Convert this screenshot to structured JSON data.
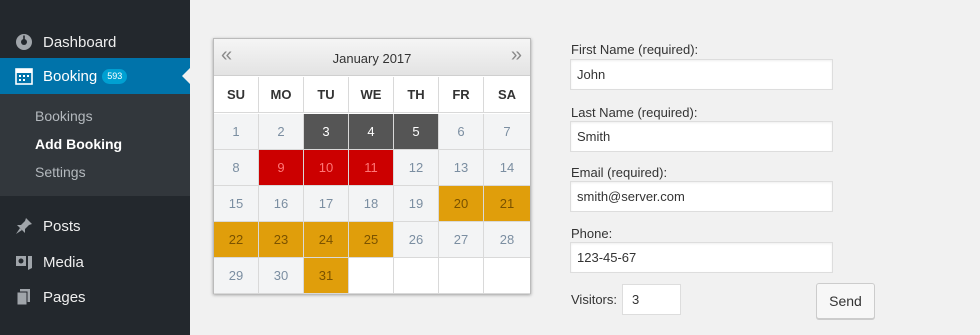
{
  "sidebar": {
    "items": [
      {
        "label": "Dashboard",
        "icon": "dashboard-icon"
      },
      {
        "label": "Booking",
        "icon": "calendar-icon",
        "badge": "593",
        "active": true
      },
      {
        "label": "Posts",
        "icon": "pin-icon"
      },
      {
        "label": "Media",
        "icon": "media-icon"
      },
      {
        "label": "Pages",
        "icon": "pages-icon"
      }
    ],
    "submenu": [
      {
        "label": "Bookings"
      },
      {
        "label": "Add Booking",
        "current": true
      },
      {
        "label": "Settings"
      }
    ]
  },
  "calendar": {
    "title": "January 2017",
    "prev": "«",
    "next": "»",
    "weekdays": [
      "SU",
      "MO",
      "TU",
      "WE",
      "TH",
      "FR",
      "SA"
    ],
    "weeks": [
      [
        {
          "d": "1",
          "s": "available"
        },
        {
          "d": "2",
          "s": "available"
        },
        {
          "d": "3",
          "s": "unavailable"
        },
        {
          "d": "4",
          "s": "unavailable"
        },
        {
          "d": "5",
          "s": "unavailable"
        },
        {
          "d": "6",
          "s": "available"
        },
        {
          "d": "7",
          "s": "available"
        }
      ],
      [
        {
          "d": "8",
          "s": "available"
        },
        {
          "d": "9",
          "s": "booked"
        },
        {
          "d": "10",
          "s": "booked"
        },
        {
          "d": "11",
          "s": "booked"
        },
        {
          "d": "12",
          "s": "available"
        },
        {
          "d": "13",
          "s": "available"
        },
        {
          "d": "14",
          "s": "available"
        }
      ],
      [
        {
          "d": "15",
          "s": "available"
        },
        {
          "d": "16",
          "s": "available"
        },
        {
          "d": "17",
          "s": "available"
        },
        {
          "d": "18",
          "s": "available"
        },
        {
          "d": "19",
          "s": "available"
        },
        {
          "d": "20",
          "s": "pending"
        },
        {
          "d": "21",
          "s": "pending"
        }
      ],
      [
        {
          "d": "22",
          "s": "pending"
        },
        {
          "d": "23",
          "s": "pending"
        },
        {
          "d": "24",
          "s": "pending"
        },
        {
          "d": "25",
          "s": "pending"
        },
        {
          "d": "26",
          "s": "available"
        },
        {
          "d": "27",
          "s": "available"
        },
        {
          "d": "28",
          "s": "available"
        }
      ],
      [
        {
          "d": "29",
          "s": "available"
        },
        {
          "d": "30",
          "s": "available"
        },
        {
          "d": "31",
          "s": "pending"
        },
        {
          "d": "",
          "s": "empty"
        },
        {
          "d": "",
          "s": "empty"
        },
        {
          "d": "",
          "s": "empty"
        },
        {
          "d": "",
          "s": "empty"
        }
      ]
    ],
    "colors": {
      "unavailable": "#555555",
      "booked": "#cc0000",
      "pending": "#e09e0b",
      "available": "#f3f4f5"
    }
  },
  "form": {
    "first_name": {
      "label": "First Name (required):",
      "value": "John"
    },
    "last_name": {
      "label": "Last Name (required):",
      "value": "Smith"
    },
    "email": {
      "label": "Email (required):",
      "value": "smith@server.com"
    },
    "phone": {
      "label": "Phone:",
      "value": "123-45-67"
    },
    "visitors": {
      "label": "Visitors:",
      "value": "3"
    },
    "send_label": "Send"
  }
}
